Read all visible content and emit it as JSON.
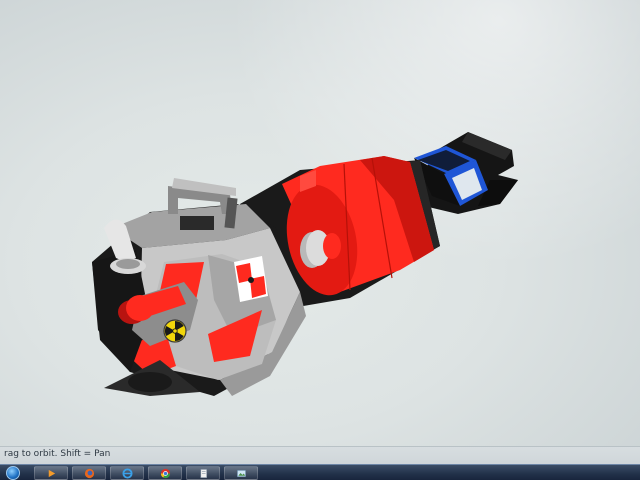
{
  "statusbar": {
    "hint": "rag to orbit. Shift = Pan"
  },
  "colors": {
    "model_red": "#ff2a1f",
    "model_gray": "#9a9a9a",
    "model_dark": "#1b1b1b",
    "screen_blue": "#1f56d6",
    "background": "#dde3e3"
  },
  "taskbar": {
    "items": [
      {
        "icon": "start-orb-icon"
      },
      {
        "icon": "media-player-icon"
      },
      {
        "icon": "firefox-icon"
      },
      {
        "icon": "internet-explorer-icon"
      },
      {
        "icon": "chrome-icon"
      },
      {
        "icon": "document-icon"
      },
      {
        "icon": "image-viewer-icon"
      }
    ]
  }
}
